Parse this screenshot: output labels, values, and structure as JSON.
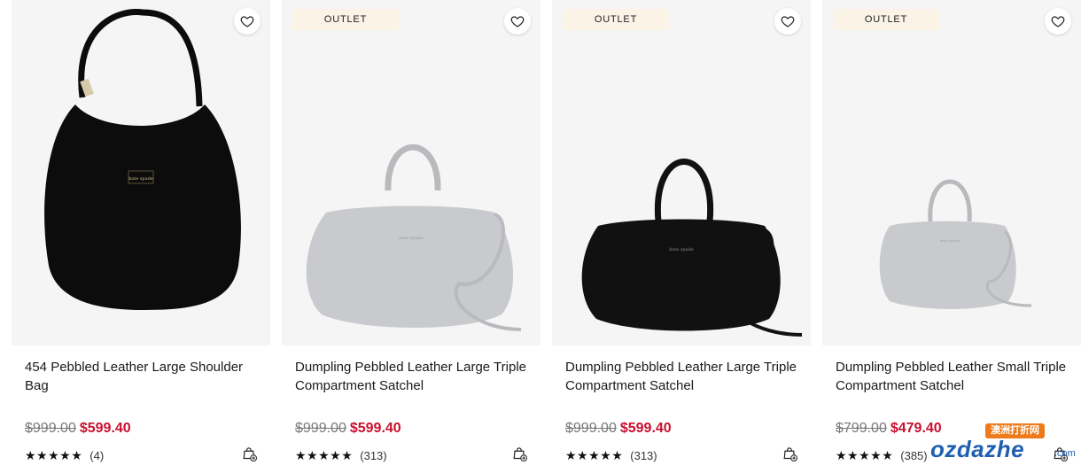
{
  "products": [
    {
      "badge": "",
      "name": "454 Pebbled Leather Large Shoulder Bag",
      "original_price": "$999.00",
      "sale_price": "$599.40",
      "stars": "★★★★★",
      "rating": 5,
      "review_count": "(4)",
      "bag_color": "#0c0c0c",
      "bag_style": "shoulder"
    },
    {
      "badge": "OUTLET",
      "name": "Dumpling Pebbled Leather Large Triple Compartment Satchel",
      "original_price": "$999.00",
      "sale_price": "$599.40",
      "stars": "★★★★★",
      "rating": 5,
      "review_count": "(313)",
      "bag_color": "#c9cacd",
      "bag_style": "satchel-large"
    },
    {
      "badge": "OUTLET",
      "name": "Dumpling Pebbled Leather Large Triple Compartment Satchel",
      "original_price": "$999.00",
      "sale_price": "$599.40",
      "stars": "★★★★★",
      "rating": 5,
      "review_count": "(313)",
      "bag_color": "#111111",
      "bag_style": "satchel-large"
    },
    {
      "badge": "OUTLET",
      "name": "Dumpling Pebbled Leather Small Triple Compartment Satchel",
      "original_price": "$799.00",
      "sale_price": "$479.40",
      "stars": "★★★★★",
      "rating": 5,
      "review_count": "(385)",
      "bag_color": "#c9cacd",
      "bag_style": "satchel-small"
    }
  ],
  "icons": {
    "wishlist": "heart-icon",
    "add_to_bag": "shopping-bag-plus-icon"
  },
  "watermark": {
    "top": "澳洲打折网",
    "text": "ozdazhe",
    "suffix": ".com"
  },
  "colors": {
    "sale": "#c8102e",
    "original": "#777777",
    "badge_bg": "#fbf3e6",
    "image_bg": "#f5f5f5"
  }
}
